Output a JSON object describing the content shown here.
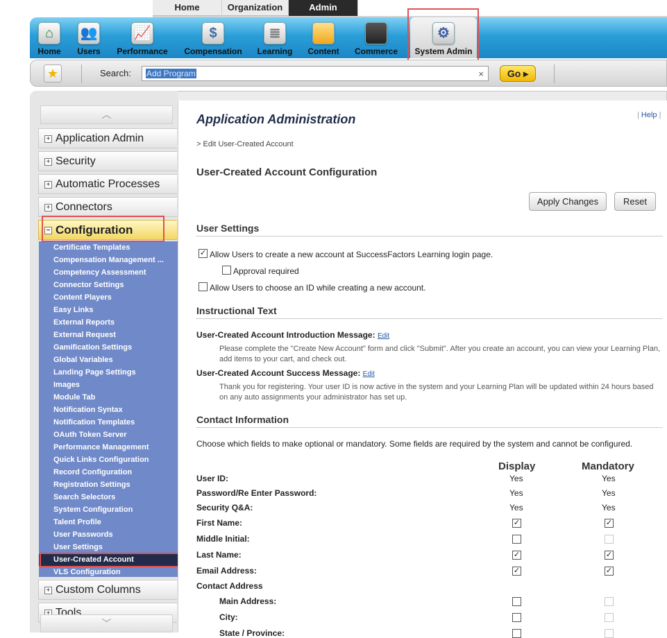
{
  "top_tabs": [
    "Home",
    "Organization",
    "Admin"
  ],
  "modules": [
    "Home",
    "Users",
    "Performance",
    "Compensation",
    "Learning",
    "Content",
    "Commerce",
    "System Admin"
  ],
  "search": {
    "label": "Search:",
    "value": "Add Program",
    "clear": "×",
    "go": "Go ▸"
  },
  "leftnav": {
    "categories": [
      "Application Admin",
      "Security",
      "Automatic Processes",
      "Connectors",
      "Configuration",
      "Custom Columns",
      "Tools"
    ],
    "config_items": [
      "Certificate Templates",
      "Compensation Management ...",
      "Competency Assessment",
      "Connector Settings",
      "Content Players",
      "Easy Links",
      "External Reports",
      "External Request",
      "Gamification Settings",
      "Global Variables",
      "Landing Page Settings",
      "Images",
      "Module Tab",
      "Notification Syntax",
      "Notification Templates",
      "OAuth Token Server",
      "Performance Management",
      "Quick Links Configuration",
      "Record Configuration",
      "Registration Settings",
      "Search Selectors",
      "System Configuration",
      "Talent Profile",
      "User Passwords",
      "User Settings",
      "User-Created Account",
      "VLS Configuration"
    ]
  },
  "page": {
    "title": "Application Administration",
    "help": "Help",
    "breadcrumb": "> Edit User-Created Account",
    "heading": "User-Created Account Configuration",
    "apply": "Apply Changes",
    "reset": "Reset"
  },
  "user_settings": {
    "title": "User Settings",
    "opt1": "Allow Users to create a new account at SuccessFactors Learning login page.",
    "opt2": "Approval required",
    "opt3": "Allow Users to choose an ID while creating a new account.",
    "opt1_checked": true,
    "opt2_checked": false,
    "opt3_checked": false
  },
  "instructional": {
    "title": "Instructional Text",
    "intro_label": "User-Created Account Introduction Message:",
    "intro_text": "Please complete the \"Create New Account\" form and click \"Submit\". After you create an account, you can view your Learning Plan, add items to your cart, and check out.",
    "success_label": "User-Created Account Success Message:",
    "success_text": "Thank you for registering. Your user ID is now active in the system and your Learning Plan will be updated within 24 hours based on any auto assignments your administrator has set up.",
    "edit": "Edit"
  },
  "contact": {
    "title": "Contact Information",
    "desc": "Choose which fields to make optional or mandatory. Some fields are required by the system and cannot be configured.",
    "col_display": "Display",
    "col_mandatory": "Mandatory",
    "rows": [
      {
        "label": "User ID:",
        "display": "Yes",
        "mandatory": "Yes"
      },
      {
        "label": "Password/Re Enter Password:",
        "display": "Yes",
        "mandatory": "Yes"
      },
      {
        "label": "Security Q&A:",
        "display": "Yes",
        "mandatory": "Yes"
      },
      {
        "label": "First Name:",
        "display": true,
        "mandatory": true
      },
      {
        "label": "Middle Initial:",
        "display": false,
        "mandatory": "disabled"
      },
      {
        "label": "Last Name:",
        "display": true,
        "mandatory": true
      },
      {
        "label": "Email Address:",
        "display": true,
        "mandatory": true
      }
    ],
    "group": "Contact Address",
    "sub_rows": [
      {
        "label": "Main Address:",
        "display": false,
        "mandatory": "disabled"
      },
      {
        "label": "City:",
        "display": false,
        "mandatory": "disabled"
      },
      {
        "label": "State / Province:",
        "display": false,
        "mandatory": "disabled"
      }
    ]
  },
  "colors": {
    "accent_blue": "#2a9ed8",
    "nav_blue": "#7089c9",
    "highlight": "#e05050",
    "selected_item": "#222b4a"
  }
}
